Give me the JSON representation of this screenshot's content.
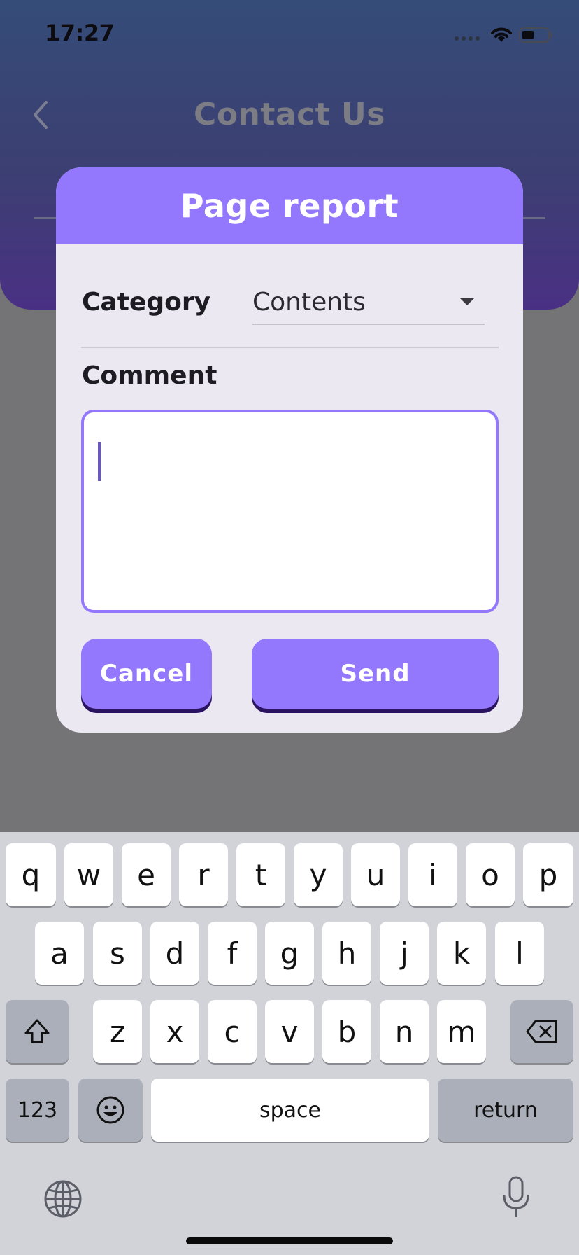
{
  "status_bar": {
    "time": "17:27"
  },
  "screen": {
    "title": "Contact Us"
  },
  "dialog": {
    "title": "Page report",
    "category_label": "Category",
    "category_value": "Contents",
    "comment_label": "Comment",
    "comment_value": "",
    "cancel_label": "Cancel",
    "send_label": "Send"
  },
  "keyboard": {
    "row1": [
      "q",
      "w",
      "e",
      "r",
      "t",
      "y",
      "u",
      "i",
      "o",
      "p"
    ],
    "row2": [
      "a",
      "s",
      "d",
      "f",
      "g",
      "h",
      "j",
      "k",
      "l"
    ],
    "row3": [
      "z",
      "x",
      "c",
      "v",
      "b",
      "n",
      "m"
    ],
    "numbers_label": "123",
    "space_label": "space",
    "return_label": "return"
  },
  "colors": {
    "accent": "#9378fd",
    "dialog_background": "#ece8f2",
    "header_gradient_top": "#354c78",
    "header_gradient_bottom": "#4a3084"
  }
}
